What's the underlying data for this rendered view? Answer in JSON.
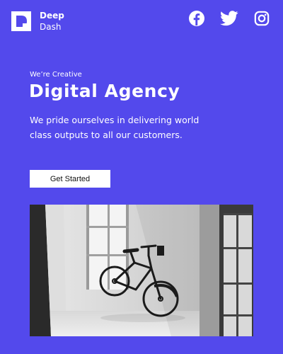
{
  "brand": {
    "line1": "Deep",
    "line2": "Dash",
    "logo_icon": "letter-d-logo-icon"
  },
  "social": [
    {
      "name": "Facebook",
      "icon": "facebook-icon"
    },
    {
      "name": "Twitter",
      "icon": "twitter-icon"
    },
    {
      "name": "Instagram",
      "icon": "instagram-icon"
    }
  ],
  "hero": {
    "eyebrow": "We’re Creative",
    "title": "Digital Agency",
    "description": "We pride ourselves in delivering world class outputs to all our customers.",
    "cta_label": "Get Started"
  },
  "colors": {
    "background": "#5349ec",
    "text": "#ffffff",
    "button_bg": "#ffffff",
    "button_text": "#111111"
  }
}
